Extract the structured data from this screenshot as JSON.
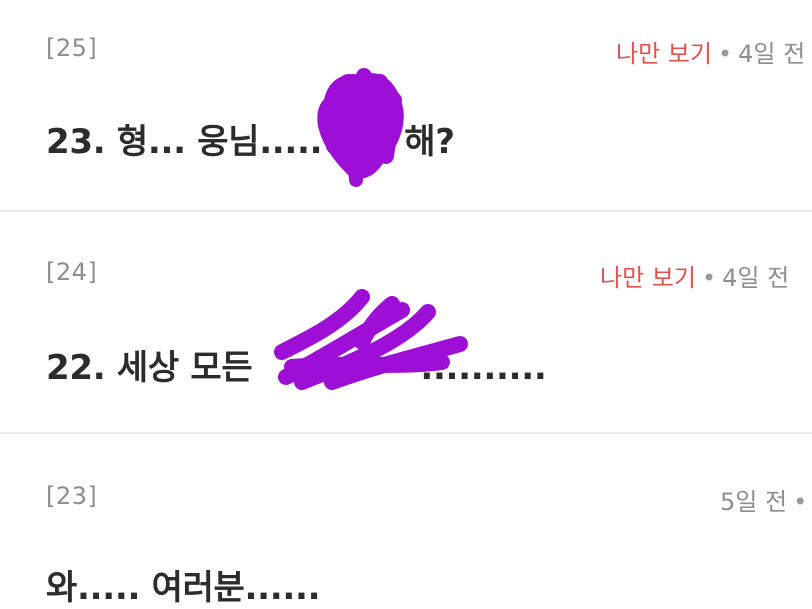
{
  "posts": [
    {
      "number": "[25]",
      "private_label": "나만 보기",
      "separator": "•",
      "time": "4일 전",
      "title": "23. 형... 웅님.....",
      "title_end": "해?"
    },
    {
      "number": "[24]",
      "private_label": "나만 보기",
      "separator": "•",
      "time": "4일 전",
      "title": "22. 세상 모든",
      "title_end": ".........."
    },
    {
      "number": "[23]",
      "time": "5일 전",
      "separator": "•",
      "title": "와..... 여러분......"
    }
  ],
  "colors": {
    "private_label": "#e0524b",
    "meta_text": "#8e8e8e",
    "title_text": "#2c2c2c",
    "divider": "#ececec",
    "scribble": "#9d0fd6"
  },
  "icons": [
    "redaction-scribble"
  ]
}
